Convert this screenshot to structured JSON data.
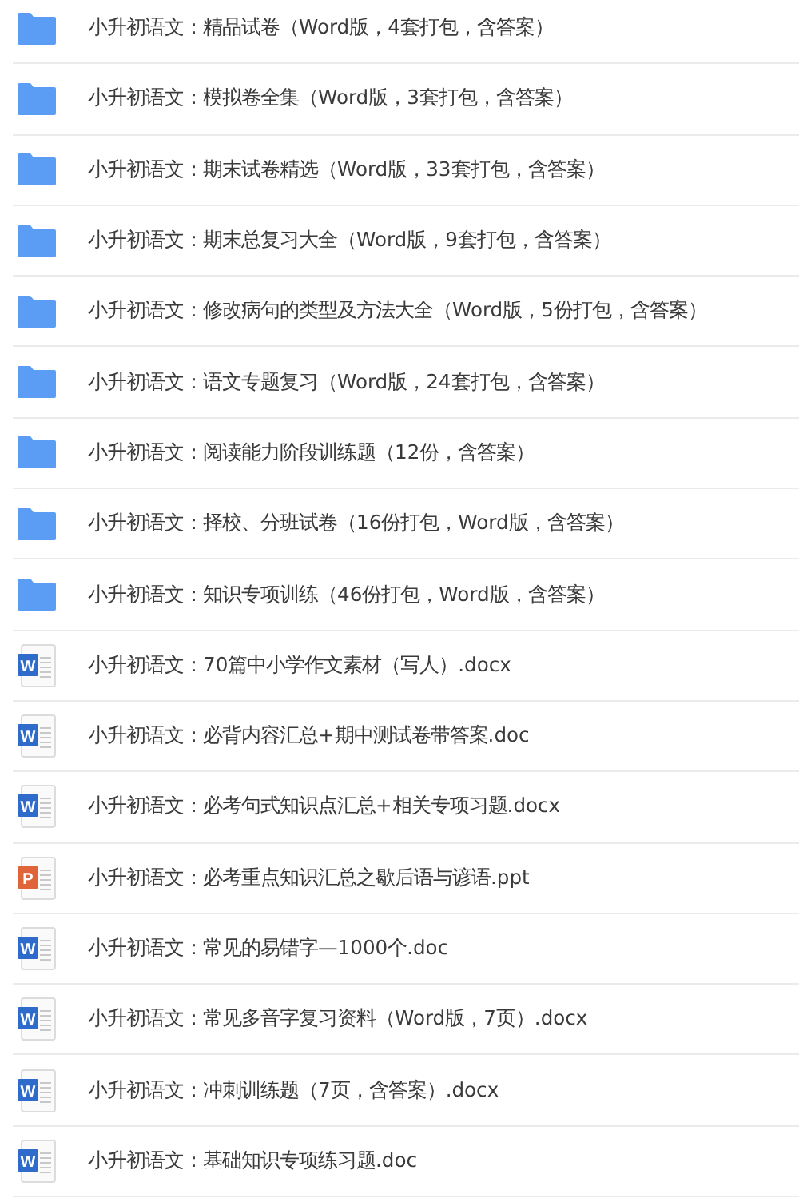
{
  "files": [
    {
      "kind": "folder",
      "name": "小升初语文：精品试卷（Word版，4套打包，含答案）"
    },
    {
      "kind": "folder",
      "name": "小升初语文：模拟卷全集（Word版，3套打包，含答案）"
    },
    {
      "kind": "folder",
      "name": "小升初语文：期末试卷精选（Word版，33套打包，含答案）"
    },
    {
      "kind": "folder",
      "name": "小升初语文：期末总复习大全（Word版，9套打包，含答案）"
    },
    {
      "kind": "folder",
      "name": "小升初语文：修改病句的类型及方法大全（Word版，5份打包，含答案）"
    },
    {
      "kind": "folder",
      "name": "小升初语文：语文专题复习（Word版，24套打包，含答案）"
    },
    {
      "kind": "folder",
      "name": "小升初语文：阅读能力阶段训练题（12份，含答案）"
    },
    {
      "kind": "folder",
      "name": "小升初语文：择校、分班试卷（16份打包，Word版，含答案）"
    },
    {
      "kind": "folder",
      "name": "小升初语文：知识专项训练（46份打包，Word版，含答案）"
    },
    {
      "kind": "word",
      "badge": "W",
      "name": "小升初语文：70篇中小学作文素材（写人）.docx"
    },
    {
      "kind": "word",
      "badge": "W",
      "name": "小升初语文：必背内容汇总+期中测试卷带答案.doc"
    },
    {
      "kind": "word",
      "badge": "W",
      "name": "小升初语文：必考句式知识点汇总+相关专项习题.docx"
    },
    {
      "kind": "powerpoint",
      "badge": "P",
      "name": "小升初语文：必考重点知识汇总之歇后语与谚语.ppt"
    },
    {
      "kind": "word",
      "badge": "W",
      "name": "小升初语文：常见的易错字—1000个.doc"
    },
    {
      "kind": "word",
      "badge": "W",
      "name": "小升初语文：常见多音字复习资料（Word版，7页）.docx"
    },
    {
      "kind": "word",
      "badge": "W",
      "name": "小升初语文：冲刺训练题（7页，含答案）.docx"
    },
    {
      "kind": "word",
      "badge": "W",
      "name": "小升初语文：基础知识专项练习题.doc"
    }
  ]
}
